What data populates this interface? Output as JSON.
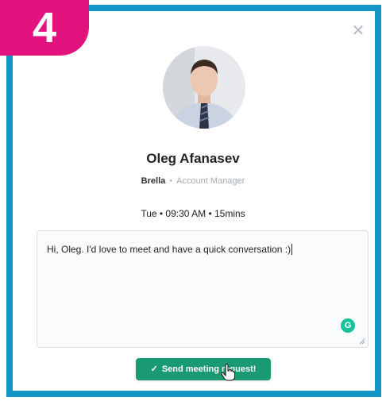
{
  "step_badge": "4",
  "modal": {
    "close_icon": "close-icon",
    "contact": {
      "name": "Oleg Afanasev",
      "company": "Brella",
      "separator": "•",
      "role": "Account Manager"
    },
    "meeting_time": "Tue • 09:30 AM • 15mins",
    "message": {
      "value": "Hi, Oleg. I'd love to meet and have a quick conversation :)",
      "grammarly_icon": "grammarly-icon"
    },
    "send_button": {
      "label": "Send meeting request!",
      "icon": "check-icon"
    }
  },
  "colors": {
    "frame": "#1596c9",
    "badge": "#e3127f",
    "send_button": "#1a9a72",
    "grammarly": "#15c39a"
  }
}
